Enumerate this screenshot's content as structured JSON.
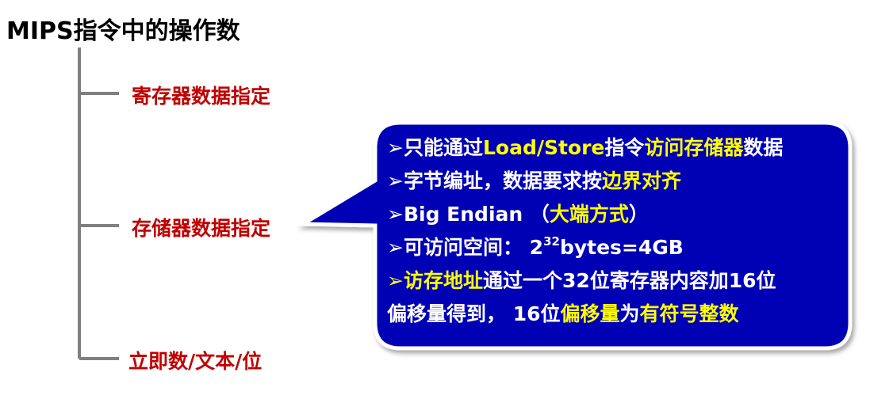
{
  "title": "MIPS指令中的操作数",
  "branches": [
    {
      "label": "寄存器数据指定"
    },
    {
      "label": "存储器数据指定"
    },
    {
      "label": "立即数/文本/位"
    }
  ],
  "callout": {
    "bullet": "➢",
    "line1": {
      "a": "只能通过",
      "b": "Load/Store",
      "c": "指令",
      "d": "访问存储器",
      "e": "数据"
    },
    "line2": {
      "a": "字节编址，数据要求按",
      "b": "边界对齐"
    },
    "line3": {
      "a": "Big Endian （",
      "b": "大端方式",
      "c": "）"
    },
    "line4": {
      "a": "可访问空间：  2",
      "sup": "32",
      "b": "bytes=4GB"
    },
    "line5": {
      "a": "访存地址",
      "b": "通过一个32位寄存器内容加16位"
    },
    "line6": {
      "a": "偏移量得到， 16位",
      "b": "偏移量",
      "c": "为",
      "d": "有符号整数"
    }
  },
  "colors": {
    "branch_text": "#c00000",
    "callout_fill": "#0000b4",
    "callout_highlight": "#ffff00",
    "tree_line": "#7f7f7f"
  }
}
